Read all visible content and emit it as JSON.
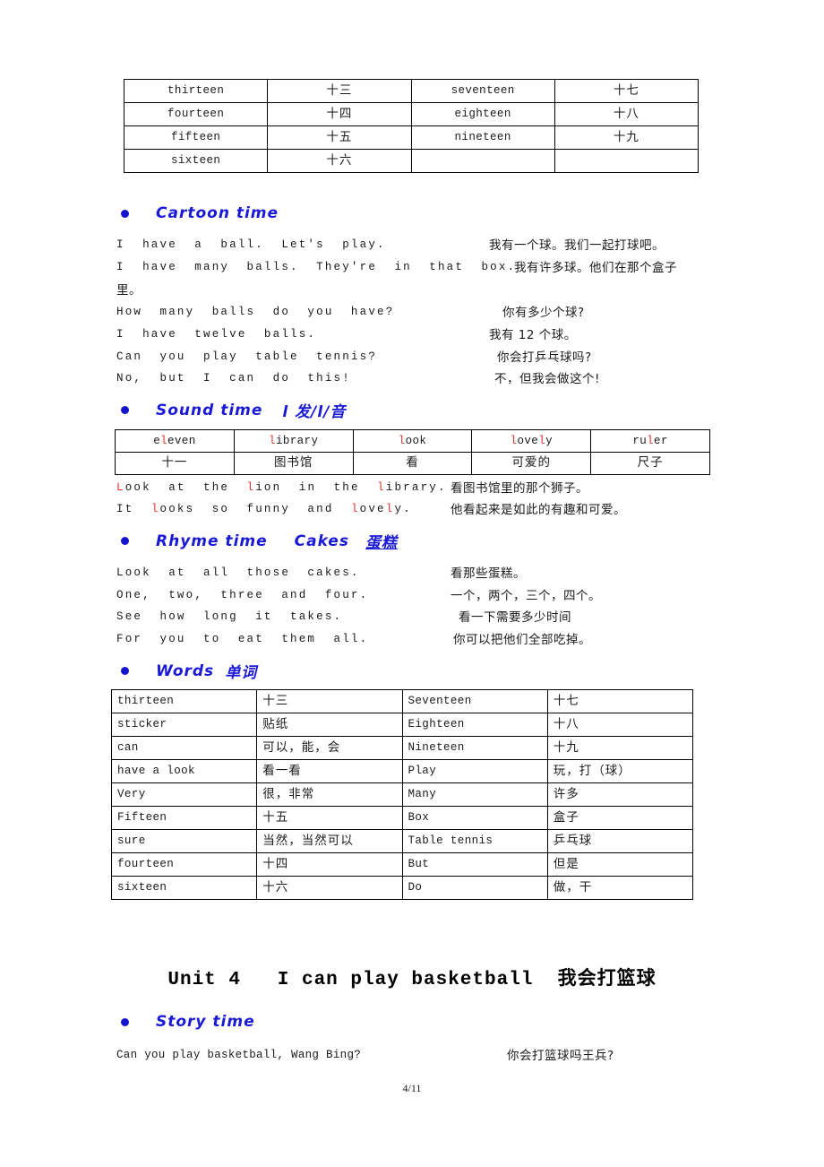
{
  "document": {
    "page_number": "4/11"
  },
  "numbers_table": {
    "rows": [
      [
        "thirteen",
        "十三",
        "seventeen",
        "十七"
      ],
      [
        "fourteen",
        "十四",
        "eighteen",
        "十八"
      ],
      [
        "fifteen",
        "十五",
        "nineteen",
        "十九"
      ],
      [
        "sixteen",
        "十六",
        "",
        ""
      ]
    ]
  },
  "cartoon_time": {
    "heading_en": "Cartoon  time",
    "lines": [
      {
        "en": "I  have  a  ball.  Let's  play.",
        "cn": "我有一个球。我们一起打球吧。"
      },
      {
        "en": "I  have  many  balls.  They're  in  that  box.",
        "cn": "我有许多球。他们在那个盒子"
      },
      {
        "en": "里。",
        "cn": ""
      },
      {
        "en": "How  many  balls  do  you  have?",
        "cn": "你有多少个球?"
      },
      {
        "en": "I  have  twelve  balls.",
        "cn": "我有 12 个球。"
      },
      {
        "en": "Can  you  play  table  tennis?",
        "cn": "你会打乒乓球吗?"
      },
      {
        "en": "No,  but  I  can  do  this!",
        "cn": "不，但我会做这个!"
      }
    ]
  },
  "sound_time": {
    "heading_en": "Sound  time",
    "heading_cn": "l 发/l/音",
    "words": [
      "eleven",
      "library",
      "look",
      "lovely",
      "ruler"
    ],
    "meanings": [
      "十一",
      "图书馆",
      "看",
      "可爱的",
      "尺子"
    ],
    "sentences": [
      {
        "en": "Look  at  the  lion  in  the  library.",
        "cn": "看图书馆里的那个狮子。"
      },
      {
        "en": "It  looks  so  funny  and  lovely.",
        "cn": "他看起来是如此的有趣和可爱。"
      }
    ]
  },
  "rhyme_time": {
    "heading_en": "Rhyme  time",
    "heading_title": "Cakes",
    "heading_cn": "蛋糕",
    "lines": [
      {
        "en": "Look  at  all  those  cakes.",
        "cn": "看那些蛋糕。"
      },
      {
        "en": "One,  two,  three  and  four.",
        "cn": "一个，两个，三个，四个。"
      },
      {
        "en": "See  how  long  it  takes.",
        "cn": "看一下需要多少时间"
      },
      {
        "en": "For  you  to  eat  them  all.",
        "cn": "你可以把他们全部吃掉。"
      }
    ]
  },
  "words_section": {
    "heading_en": "Words",
    "heading_cn": "单词",
    "rows": [
      [
        "thirteen",
        "十三",
        "Seventeen",
        "十七"
      ],
      [
        "sticker",
        "贴纸",
        "Eighteen",
        "十八"
      ],
      [
        "can",
        "可以，能，会",
        "Nineteen",
        "十九"
      ],
      [
        "have  a  look",
        "看一看",
        "Play",
        "玩，打（球）"
      ],
      [
        "Very",
        "很，非常",
        "Many",
        "许多"
      ],
      [
        "Fifteen",
        "十五",
        "Box",
        "盒子"
      ],
      [
        "sure",
        "当然，当然可以",
        "Table tennis",
        "乒乓球"
      ],
      [
        "fourteen",
        "十四",
        "But",
        "但是"
      ],
      [
        "sixteen",
        "十六",
        "Do",
        "做，干"
      ]
    ]
  },
  "unit4": {
    "title_en": "Unit 4   I can play basketball  ",
    "title_cn": "我会打篮球",
    "story_time": {
      "heading_en": "Story time",
      "lines": [
        {
          "en": "Can you play basketball, Wang Bing?",
          "cn": "你会打篮球吗王兵?"
        }
      ]
    }
  },
  "colors": {
    "heading_blue": "#1a1ad6",
    "highlight_red": "#e8332a",
    "text_black": "#1a1a1a"
  }
}
